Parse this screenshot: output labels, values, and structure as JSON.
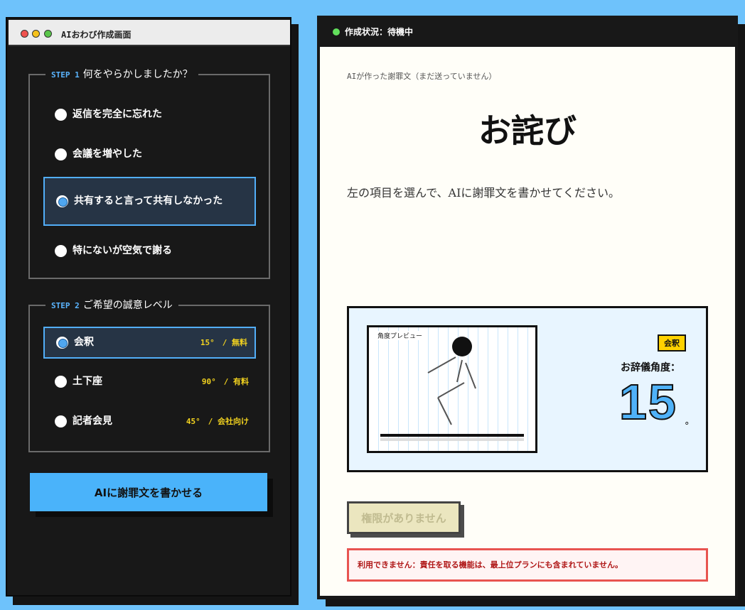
{
  "window": {
    "title": "AIおわび作成画面"
  },
  "step1": {
    "step_label": "STEP 1",
    "question": "何をやらかしましたか？",
    "options": [
      {
        "label": "返信を完全に忘れた",
        "selected": false
      },
      {
        "label": "会議を増やした",
        "selected": false
      },
      {
        "label": "共有すると言って共有しなかった",
        "selected": true
      },
      {
        "label": "特にないが空気で謝る",
        "selected": false
      }
    ]
  },
  "step2": {
    "step_label": "STEP 2",
    "question": "ご希望の誠意レベル",
    "options": [
      {
        "label": "会釈",
        "meta": "15°　/ 無料",
        "selected": true
      },
      {
        "label": "土下座",
        "meta": "90°　/ 有料",
        "selected": false
      },
      {
        "label": "記者会見",
        "meta": "45°　/ 会社向け",
        "selected": false
      }
    ]
  },
  "generate_button": "AIに謝罪文を書かせる",
  "status": {
    "text": "作成状況：待機中",
    "color": "#62e05c"
  },
  "document": {
    "draft_label": "AIが作った謝罪文（まだ送っていません）",
    "title": "お詫び",
    "instruction": "左の項目を選んで、AIに謝罪文を書かせてください。"
  },
  "angle_preview": {
    "preview_label": "角度プレビュー",
    "level_badge": "会釈",
    "caption": "お辞儀角度：",
    "angle": "15",
    "unit": "°"
  },
  "disabled_button": "権限がありません",
  "error_message": "利用できません：責任を取る機能は、最上位プランにも含まれていません。",
  "colors": {
    "accent_blue": "#4ab3fa",
    "highlight_yellow": "#f3d31f",
    "error_red": "#e85450"
  }
}
